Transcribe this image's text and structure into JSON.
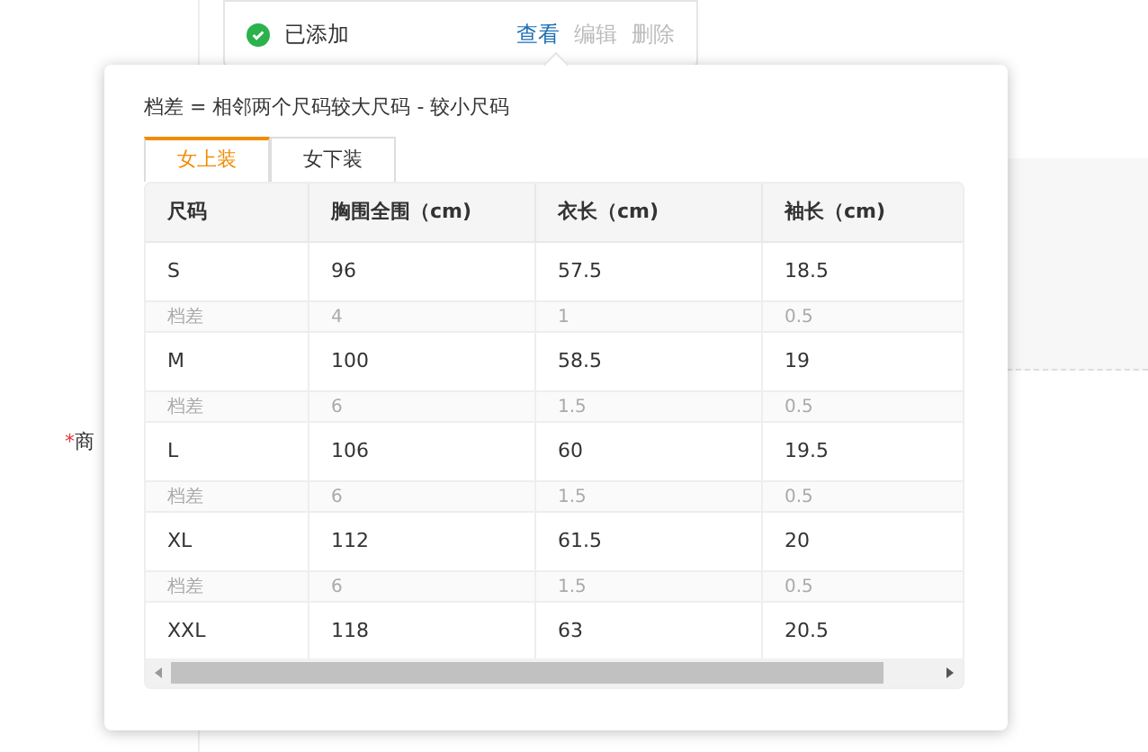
{
  "status_card": {
    "label": "已添加",
    "done": true,
    "actions": [
      {
        "label": "查看",
        "disabled": false
      },
      {
        "label": "编辑",
        "disabled": true
      },
      {
        "label": "删除",
        "disabled": true
      }
    ]
  },
  "form_labels": [
    {
      "label": "商",
      "required_mark": "*"
    }
  ],
  "popover": {
    "note": "档差 = 相邻两个尺码较大尺码 - 较小尺码",
    "tabs": [
      {
        "label": "女上装",
        "selected": true
      },
      {
        "label": "女下装",
        "selected": false
      }
    ],
    "table": {
      "columns": [
        "尺码",
        "胸围全围（cm)",
        "衣长（cm)",
        "袖长（cm)"
      ],
      "rows": [
        {
          "kind": "size",
          "cells": [
            "S",
            "96",
            "57.5",
            "18.5"
          ]
        },
        {
          "kind": "diff",
          "cells": [
            "档差",
            "4",
            "1",
            "0.5"
          ]
        },
        {
          "kind": "size",
          "cells": [
            "M",
            "100",
            "58.5",
            "19"
          ]
        },
        {
          "kind": "diff",
          "cells": [
            "档差",
            "6",
            "1.5",
            "0.5"
          ]
        },
        {
          "kind": "size",
          "cells": [
            "L",
            "106",
            "60",
            "19.5"
          ]
        },
        {
          "kind": "diff",
          "cells": [
            "档差",
            "6",
            "1.5",
            "0.5"
          ]
        },
        {
          "kind": "size",
          "cells": [
            "XL",
            "112",
            "61.5",
            "20"
          ]
        },
        {
          "kind": "diff",
          "cells": [
            "档差",
            "6",
            "1.5",
            "0.5"
          ]
        },
        {
          "kind": "size",
          "cells": [
            "XXL",
            "118",
            "63",
            "20.5"
          ]
        }
      ]
    }
  }
}
